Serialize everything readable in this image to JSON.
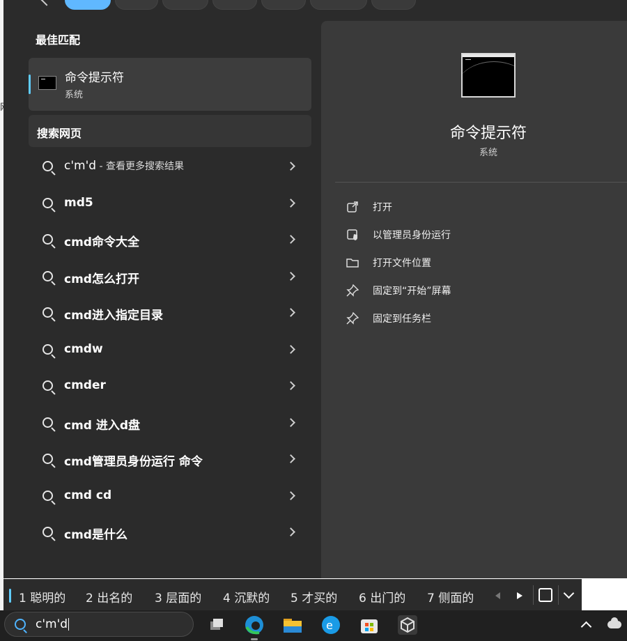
{
  "best_match": {
    "section_title": "最佳匹配",
    "name": "命令提示符",
    "subtitle": "系统"
  },
  "web_search": {
    "section_title": "搜索网页",
    "results": [
      {
        "query": "c'm'd",
        "suffix": " - 查看更多搜索结果",
        "bold": false
      },
      {
        "query": "md5",
        "suffix": "",
        "bold": true
      },
      {
        "query": "cmd命令大全",
        "suffix": "",
        "bold": true
      },
      {
        "query": "cmd怎么打开",
        "suffix": "",
        "bold": true
      },
      {
        "query": "cmd进入指定目录",
        "suffix": "",
        "bold": true
      },
      {
        "query": "cmdw",
        "suffix": "",
        "bold": true
      },
      {
        "query": "cmder",
        "suffix": "",
        "bold": true
      },
      {
        "query": "cmd 进入d盘",
        "suffix": "",
        "bold": true
      },
      {
        "query": "cmd管理员身份运行 命令",
        "suffix": "",
        "bold": true
      },
      {
        "query": "cmd cd",
        "suffix": "",
        "bold": true
      },
      {
        "query": "cmd是什么",
        "suffix": "",
        "bold": true
      }
    ]
  },
  "preview": {
    "title": "命令提示符",
    "subtitle": "系统",
    "actions": [
      {
        "label": "打开",
        "icon": "open-external-icon"
      },
      {
        "label": "以管理员身份运行",
        "icon": "shield-admin-icon"
      },
      {
        "label": "打开文件位置",
        "icon": "folder-icon"
      },
      {
        "label": "固定到“开始”屏幕",
        "icon": "pin-icon"
      },
      {
        "label": "固定到任务栏",
        "icon": "pin-icon"
      }
    ]
  },
  "ime": {
    "candidates": [
      "1 聪明的",
      "2 出名的",
      "3 层面的",
      "4 沉默的",
      "5 才买的",
      "6 出门的",
      "7 侧面的"
    ]
  },
  "taskbar": {
    "search_value": "c'm'd",
    "apps": [
      "task-view-icon",
      "edge-icon",
      "file-explorer-icon",
      "edge-icon",
      "microsoft-store-icon",
      "unity-icon"
    ]
  },
  "colors": {
    "accent": "#60cdff",
    "panel_bg": "#2b2b2b",
    "preview_bg": "#3a3a3a"
  }
}
